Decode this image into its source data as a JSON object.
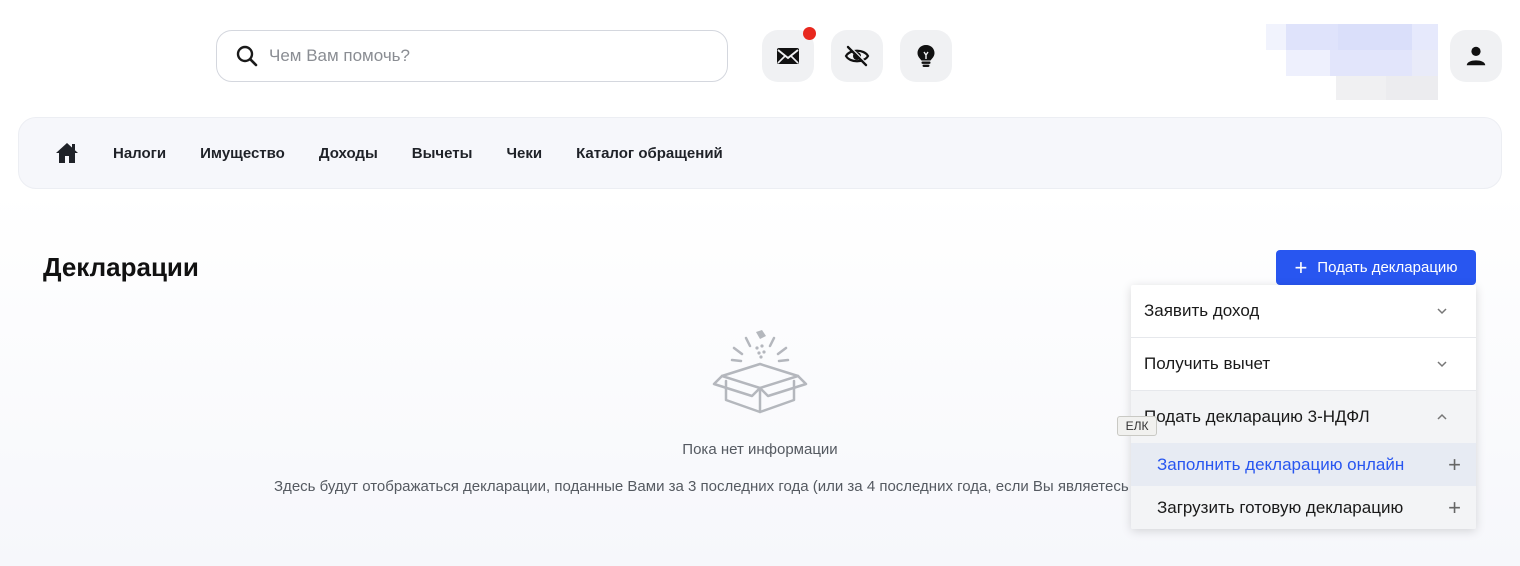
{
  "header": {
    "search": {
      "placeholder": "Чем Вам помочь?",
      "icon": "search-icon"
    },
    "buttons": [
      {
        "icon": "mail-icon",
        "has_notification": true
      },
      {
        "icon": "eye-off-icon"
      },
      {
        "icon": "lightbulb-icon"
      }
    ],
    "user_icon": "user-icon"
  },
  "nav": {
    "home_icon": "home-icon",
    "items": [
      "Налоги",
      "Имущество",
      "Доходы",
      "Вычеты",
      "Чеки",
      "Каталог обращений"
    ]
  },
  "page": {
    "title": "Декларации",
    "submit_button": {
      "plus": "+",
      "label": "Подать декларацию"
    }
  },
  "empty_state": {
    "icon": "empty-box-icon",
    "title": "Пока нет информации",
    "description": "Здесь будут отображаться декларации, поданные Вами за 3 последних года (или за 4 последних года, если Вы являетесь"
  },
  "dropdown": {
    "items": [
      {
        "label": "Заявить доход",
        "icon": "chevron-down-icon"
      },
      {
        "label": "Получить вычет",
        "icon": "chevron-down-icon"
      },
      {
        "label": "Подать декларацию 3-НДФЛ",
        "icon": "chevron-up-icon"
      }
    ],
    "subitems": [
      {
        "label": "Заполнить декларацию онлайн",
        "plus": "+"
      },
      {
        "label": "Загрузить готовую декларацию",
        "plus": "+"
      }
    ]
  },
  "tooltip": {
    "text": "ЕЛК"
  },
  "colors": {
    "accent": "#2856f0",
    "notification": "#e8281e",
    "highlight_bg": "#e7ebf3",
    "selected_section_bg": "#f3f4f6"
  }
}
